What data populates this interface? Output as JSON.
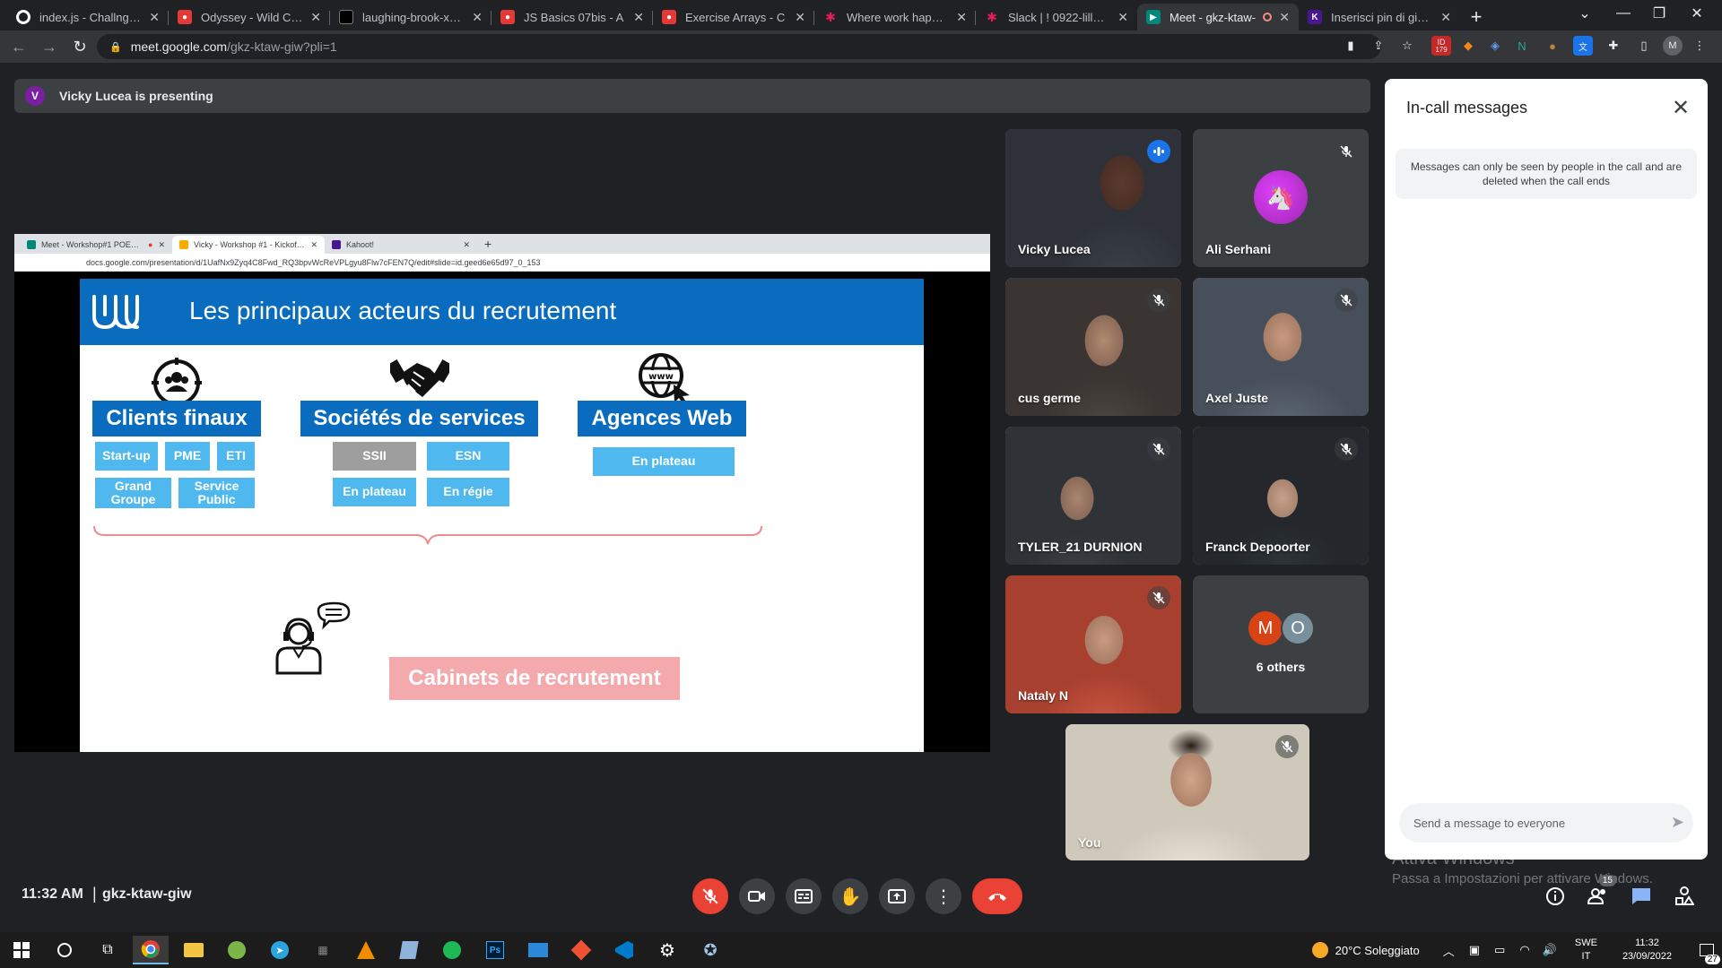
{
  "browser": {
    "tabs": [
      {
        "label": "index.js - ChallngeArra",
        "icon": "github-icon",
        "color": "#ffffff"
      },
      {
        "label": "Odyssey - Wild Code S",
        "icon": "wild-code-school-icon",
        "color": "#e53935"
      },
      {
        "label": "laughing-brook-xd2m",
        "icon": "codesandbox-icon",
        "color": "#000000"
      },
      {
        "label": "JS Basics 07bis - A",
        "icon": "wild-code-school-icon",
        "color": "#e53935"
      },
      {
        "label": "Exercise Arrays - C",
        "icon": "wild-code-school-icon",
        "color": "#e53935"
      },
      {
        "label": "Where work happens",
        "icon": "slack-icon",
        "color": "#4a154b"
      },
      {
        "label": "Slack | ! 0922-lille-php",
        "icon": "slack-icon",
        "color": "#4a154b"
      },
      {
        "label": "Meet - gkz-ktaw-",
        "icon": "google-meet-icon",
        "color": "#00897b"
      },
      {
        "label": "Inserisci pin di gioco -",
        "icon": "kahoot-icon",
        "color": "#46178f"
      }
    ],
    "url_host": "meet.google.com",
    "url_path": "/gkz-ktaw-giw?pli=1",
    "badge_count": "179"
  },
  "meet": {
    "presenter_initial": "V",
    "presenting_text": "Vicky Lucea is presenting",
    "clock": "11:32 AM",
    "separator": "|",
    "meeting_code": "gkz-ktaw-giw",
    "participants_badge": "15",
    "participants": [
      {
        "name": "Vicky Lucea",
        "speaking": true
      },
      {
        "name": "Ali Serhani",
        "muted": true
      },
      {
        "name": "cus germe",
        "muted": true
      },
      {
        "name": "Axel Juste",
        "muted": true
      },
      {
        "name": "TYLER_21 DURNION",
        "muted": true
      },
      {
        "name": "Franck Depoorter",
        "muted": true
      },
      {
        "name": "Nataly N",
        "muted": true
      }
    ],
    "others": {
      "initials": [
        "M",
        "O"
      ],
      "label": "6 others"
    },
    "self_label": "You"
  },
  "shared_screen": {
    "inner_tabs": [
      {
        "label": "Meet - Workshop#1 POEC L"
      },
      {
        "label": "Vicky - Workshop #1 - Kickoff In"
      },
      {
        "label": "Kahoot!"
      }
    ],
    "inner_url": "docs.google.com/presentation/d/1UafNx9Zyq4C8Fwd_RQ3bpvWcReVPLgyu8Flw7cFEN7Q/edit#slide=id.geed6e65d97_0_153",
    "slide": {
      "title": "Les principaux acteurs du recrutement",
      "categories": [
        {
          "title": "Clients finaux",
          "chips": [
            "Start-up",
            "PME",
            "ETI",
            "Grand Groupe",
            "Service Public"
          ]
        },
        {
          "title": "Sociétés de services",
          "chips": [
            "SSII",
            "ESN",
            "En plateau",
            "En régie"
          ]
        },
        {
          "title": "Agences Web",
          "chips": [
            "En plateau"
          ]
        }
      ],
      "cabinet": "Cabinets de recrutement"
    }
  },
  "chat_panel": {
    "title": "In-call messages",
    "note": "Messages can only be seen by people in the call and are deleted when the call ends",
    "input_placeholder": "Send a message to everyone"
  },
  "watermark": {
    "line1": "Attiva Windows",
    "line2": "Passa a Impostazioni per attivare Windows."
  },
  "taskbar": {
    "weather": "20°C Soleggiato",
    "lang_top": "SWE",
    "lang_bottom": "IT",
    "time": "11:32",
    "date": "23/09/2022",
    "notification_count": "27"
  }
}
